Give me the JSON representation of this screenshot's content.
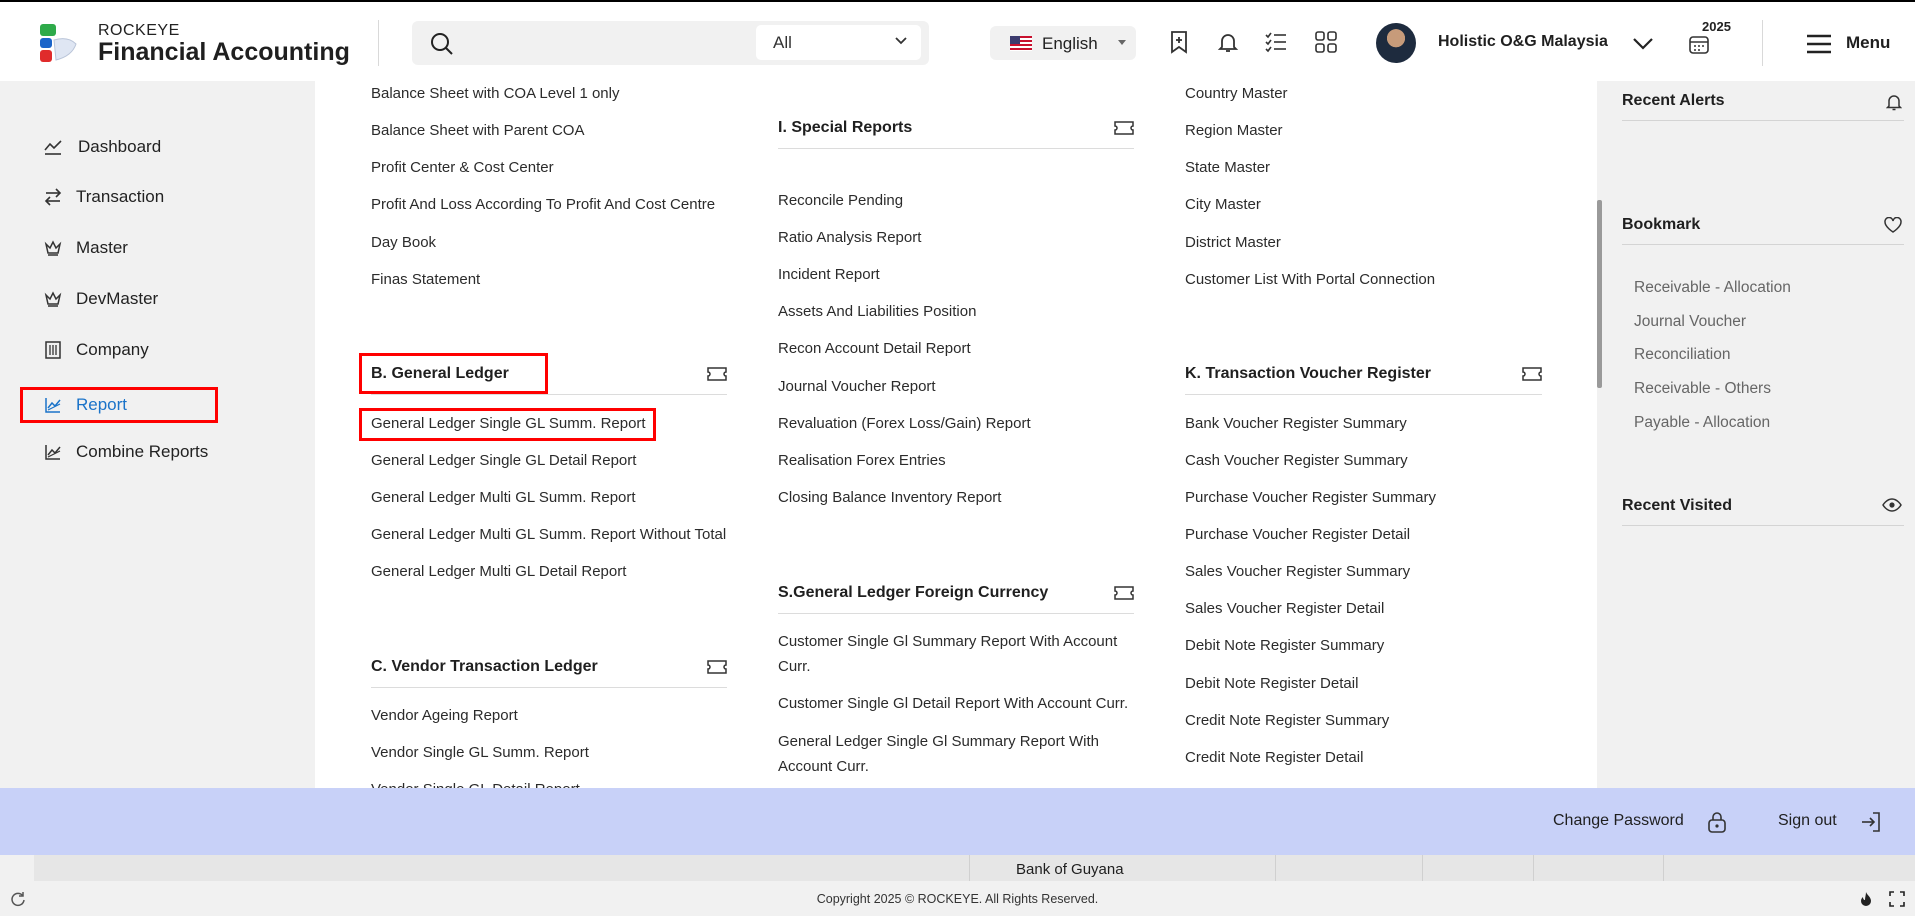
{
  "header": {
    "brand_top": "ROCKEYE",
    "brand_main": "Financial Accounting",
    "search_placeholder": "",
    "search_scope": "All",
    "language": "English",
    "company": "Holistic O&G Malaysia",
    "year": "2025",
    "menu_label": "Menu"
  },
  "nav": {
    "items": [
      {
        "label": "Dashboard",
        "icon": "chart-line-icon"
      },
      {
        "label": "Transaction",
        "icon": "arrows-exchange-icon"
      },
      {
        "label": "Master",
        "icon": "crown-icon"
      },
      {
        "label": "DevMaster",
        "icon": "crown-icon"
      },
      {
        "label": "Company",
        "icon": "building-icon"
      },
      {
        "label": "Report",
        "icon": "report-chart-icon",
        "active": true
      },
      {
        "label": "Combine Reports",
        "icon": "report-chart-icon"
      }
    ]
  },
  "col1": {
    "top_links": [
      "Balance Sheet with COA Level 1 only",
      "Balance Sheet with Parent COA",
      "Profit Center & Cost Center",
      "Profit And Loss According To Profit And Cost Centre",
      "Day Book",
      "Finas Statement"
    ],
    "gl_title": "B. General Ledger",
    "gl_links": [
      "General Ledger Single GL Summ. Report",
      "General Ledger Single GL Detail Report",
      "General Ledger Multi GL Summ. Report",
      "General Ledger Multi GL Summ. Report Without Total",
      "General Ledger Multi GL Detail Report"
    ],
    "vendor_title": "C. Vendor Transaction Ledger",
    "vendor_links": [
      "Vendor Ageing Report",
      "Vendor Single GL Summ. Report",
      "Vendor Single GL Detail Report"
    ]
  },
  "col2": {
    "special_title": "I. Special Reports",
    "special_links": [
      "Reconcile Pending",
      "Ratio Analysis Report",
      "Incident Report",
      "Assets And Liabilities Position",
      "Recon Account Detail Report",
      "Journal Voucher Report",
      "Revaluation (Forex Loss/Gain) Report",
      "Realisation Forex Entries",
      "Closing Balance Inventory Report"
    ],
    "forex_title": "S.General Ledger Foreign Currency",
    "forex_links": [
      "Customer Single Gl Summary Report With Account Curr.",
      "Customer Single Gl Detail Report With Account Curr.",
      "General Ledger Single Gl Summary Report With Account Curr."
    ]
  },
  "col3": {
    "top_links": [
      "Country Master",
      "Region Master",
      "State Master",
      "City Master",
      "District Master",
      "Customer List With Portal Connection"
    ],
    "tvr_title": "K. Transaction Voucher Register",
    "tvr_links": [
      "Bank Voucher Register Summary",
      "Cash Voucher Register Summary",
      "Purchase Voucher Register Summary",
      "Purchase Voucher Register Detail",
      "Sales Voucher Register Summary",
      "Sales Voucher Register Detail",
      "Debit Note Register Summary",
      "Debit Note Register Detail",
      "Credit Note Register Summary",
      "Credit Note Register Detail"
    ]
  },
  "right": {
    "alerts_title": "Recent Alerts",
    "bookmark_title": "Bookmark",
    "bookmarks": [
      "Receivable - Allocation",
      "Journal Voucher",
      "Reconciliation",
      "Receivable - Others",
      "Payable - Allocation"
    ],
    "visited_title": "Recent Visited"
  },
  "bottom": {
    "change_password": "Change Password",
    "sign_out": "Sign out",
    "bank_row": "Bank of Guyana",
    "copyright": "Copyright 2025 © ROCKEYE. All Rights Reserved."
  },
  "colors": {
    "highlight": "#ff0000",
    "active_nav": "#1a73c9",
    "bottom_bar": "#c8d1f8"
  }
}
